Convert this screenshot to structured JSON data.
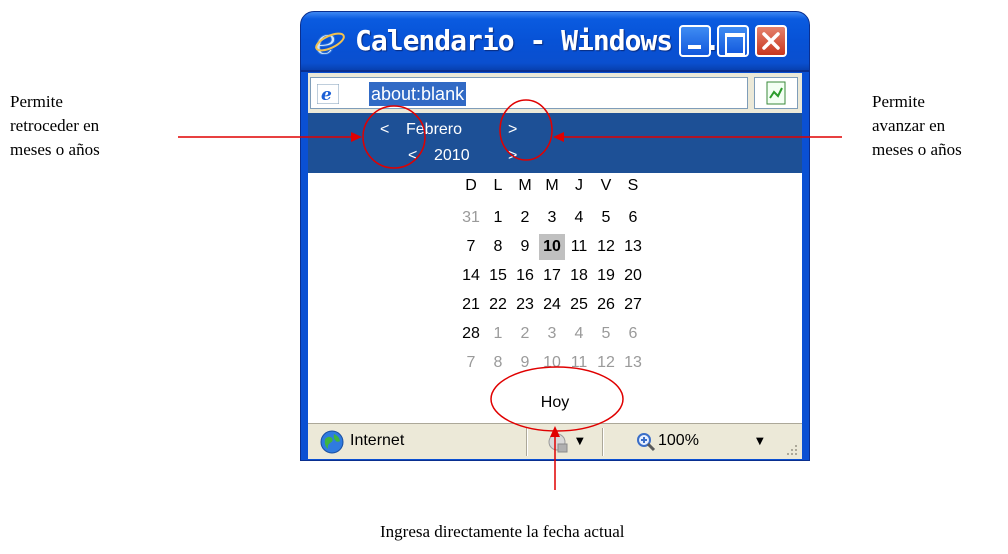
{
  "window": {
    "title": "Calendario - Windows I...",
    "address": "about:blank"
  },
  "calendar": {
    "prev": "<",
    "next": ">",
    "month": "Febrero",
    "year": "2010",
    "weekdays": [
      "D",
      "L",
      "M",
      "M",
      "J",
      "V",
      "S"
    ],
    "weeks": [
      [
        "31",
        "1",
        "2",
        "3",
        "4",
        "5",
        "6"
      ],
      [
        "7",
        "8",
        "9",
        "10",
        "11",
        "12",
        "13"
      ],
      [
        "14",
        "15",
        "16",
        "17",
        "18",
        "19",
        "20"
      ],
      [
        "21",
        "22",
        "23",
        "24",
        "25",
        "26",
        "27"
      ],
      [
        "28",
        "1",
        "2",
        "3",
        "4",
        "5",
        "6"
      ],
      [
        "7",
        "8",
        "9",
        "10",
        "11",
        "12",
        "13"
      ]
    ],
    "selected_day": "10",
    "today_label": "Hoy"
  },
  "statusbar": {
    "zone": "Internet",
    "zoom": "100%"
  },
  "annotations": {
    "left": "Permite\nretroceder en\nmeses o años",
    "right": "Permite\navanzar en\nmeses o años",
    "bottom": "Ingresa directamente la fecha actual"
  },
  "colors": {
    "title_blue": "#0752d6",
    "header_navy": "#1d5096",
    "annotation_red": "#e00000",
    "today_highlight": "#c0c0c0"
  }
}
